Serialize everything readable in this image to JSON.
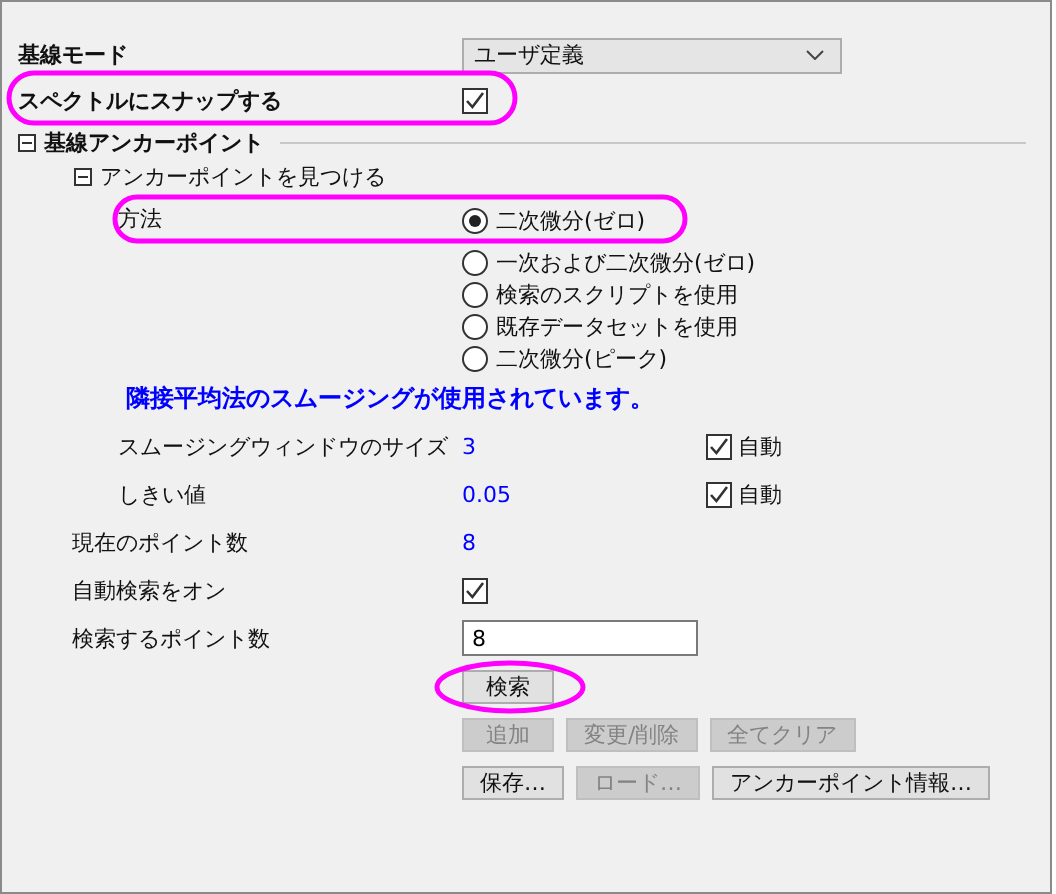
{
  "baseline_mode": {
    "label": "基線モード",
    "value": "ユーザ定義"
  },
  "snap_to_spectrum": {
    "label": "スペクトルにスナップする",
    "checked": true,
    "highlighted": true
  },
  "anchor_section": {
    "title": "基線アンカーポイント",
    "expanded": true,
    "find_group": {
      "title": "アンカーポイントを見つける",
      "expanded": true,
      "method": {
        "label": "方法",
        "highlighted": true,
        "options": [
          {
            "label": "二次微分(ゼロ)",
            "selected": true
          },
          {
            "label": "一次および二次微分(ゼロ)",
            "selected": false
          },
          {
            "label": "検索のスクリプトを使用",
            "selected": false
          },
          {
            "label": "既存データセットを使用",
            "selected": false
          },
          {
            "label": "二次微分(ピーク)",
            "selected": false
          }
        ]
      },
      "note": "隣接平均法のスムージングが使用されています。",
      "params": [
        {
          "label": "スムージングウィンドウのサイズ",
          "value": "3",
          "auto_label": "自動",
          "auto_checked": true
        },
        {
          "label": "しきい値",
          "value": "0.05",
          "auto_label": "自動",
          "auto_checked": true
        }
      ]
    },
    "current_points": {
      "label": "現在のポイント数",
      "value": "8"
    },
    "auto_search": {
      "label": "自動検索をオン",
      "checked": true
    },
    "points_to_find": {
      "label": "検索するポイント数",
      "value": "8"
    },
    "button_rows": [
      [
        {
          "label": "検索",
          "disabled": false,
          "highlighted": true
        }
      ],
      [
        {
          "label": "追加",
          "disabled": true,
          "highlighted": false
        },
        {
          "label": "変更/削除",
          "disabled": true,
          "highlighted": false
        },
        {
          "label": "全てクリア",
          "disabled": true,
          "highlighted": false
        }
      ],
      [
        {
          "label": "保存…",
          "disabled": false,
          "highlighted": false
        },
        {
          "label": "ロード…",
          "disabled": true,
          "highlighted": false
        },
        {
          "label": "アンカーポイント情報…",
          "disabled": false,
          "highlighted": false
        }
      ]
    ]
  }
}
